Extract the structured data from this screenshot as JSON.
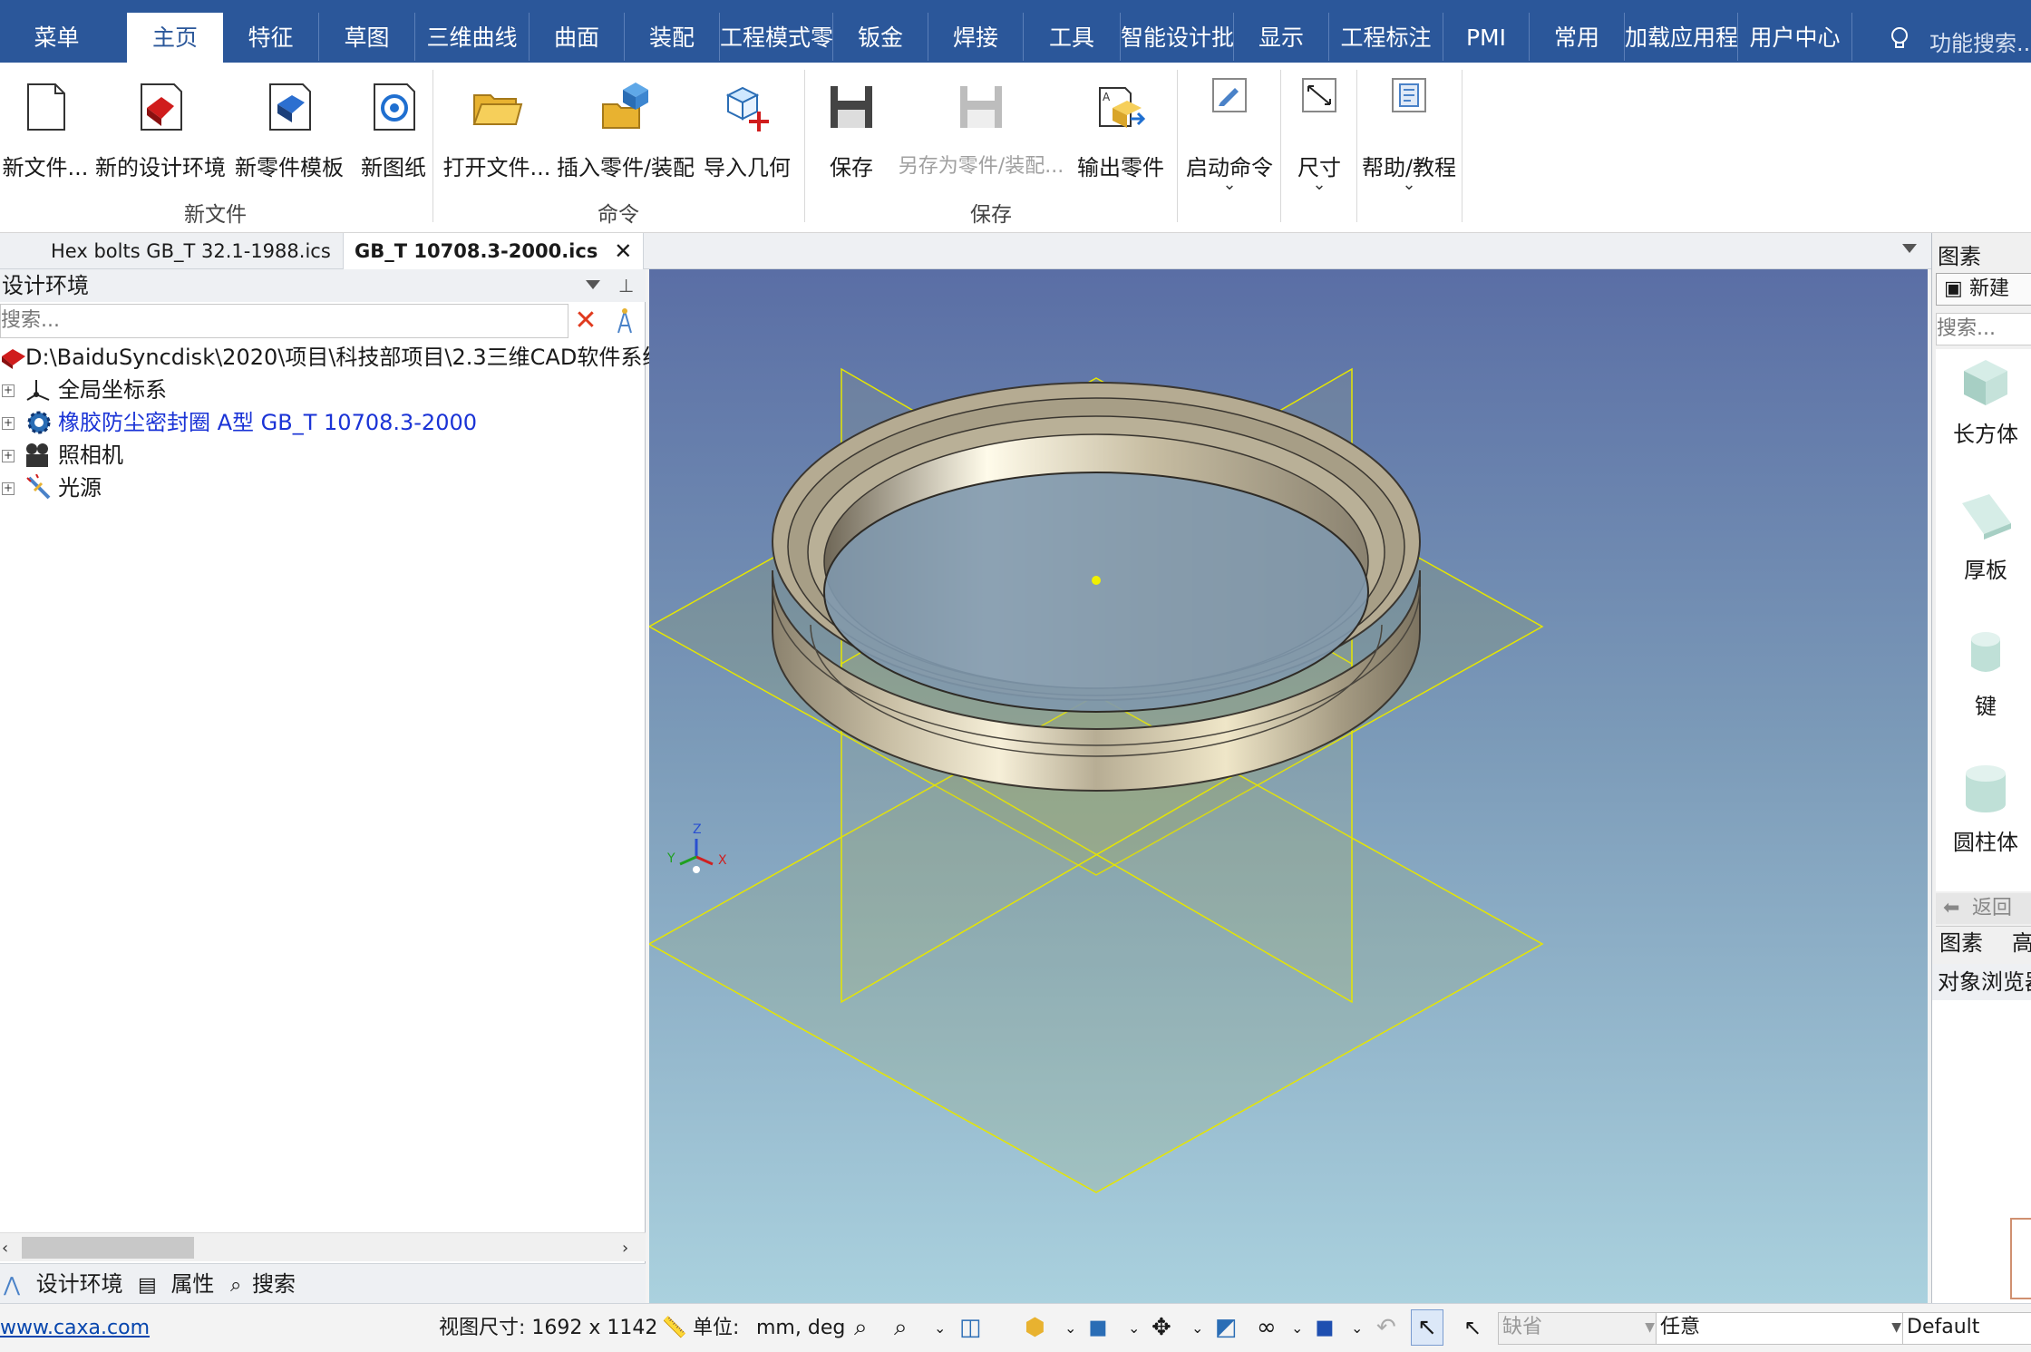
{
  "menubar": {
    "tabs": [
      "菜单",
      "主页",
      "特征",
      "草图",
      "三维曲线",
      "曲面",
      "装配",
      "工程模式零",
      "钣金",
      "焊接",
      "工具",
      "智能设计批",
      "显示",
      "工程标注",
      "PMI",
      "常用",
      "加载应用程",
      "用户中心"
    ],
    "search_placeholder": "功能搜索...",
    "active_tab": "主页"
  },
  "ribbon": {
    "buttons": {
      "new_file": "新文件...",
      "new_design_env": "新的设计环境",
      "new_part_template": "新零件模板",
      "new_drawing": "新图纸",
      "open_file": "打开文件...",
      "insert_part": "插入零件/装配",
      "import_geometry": "导入几何",
      "save": "保存",
      "save_as": "另存为零件/装配...",
      "export_part": "输出零件",
      "start_command": "启动命令",
      "dimension": "尺寸",
      "help": "帮助/教程"
    },
    "groups": {
      "new_file": "新文件",
      "command": "命令",
      "save": "保存"
    }
  },
  "doc_tabs": [
    {
      "label": "Hex bolts GB_T 32.1-1988.ics",
      "active": false
    },
    {
      "label": "GB_T 10708.3-2000.ics",
      "active": true
    }
  ],
  "left_panel": {
    "title": "设计环境",
    "search_placeholder": "搜索...",
    "tree": {
      "root": "D:\\BaiduSyncdisk\\2020\\项目\\科技部项目\\2.3三维CAD软件系统",
      "items": [
        "全局坐标系",
        "橡胶防尘密封圈 A型 GB_T 10708.3-2000",
        "照相机",
        "光源"
      ]
    },
    "bottom_tabs": [
      "设计环境",
      "属性",
      "搜索"
    ]
  },
  "right_panel": {
    "title": "图素",
    "new_button": "新建",
    "search_placeholder": "搜索...",
    "items": [
      "长方体",
      "厚板",
      "键",
      "圆柱体"
    ],
    "back_button": "返回",
    "bottom_tabs": [
      "图素",
      "高"
    ],
    "browser_title": "对象浏览器"
  },
  "viewport": {
    "axis_labels": {
      "x": "X",
      "y": "Y",
      "z": "Z"
    }
  },
  "statusbar": {
    "link": "www.caxa.com",
    "view_size": "视图尺寸: 1692 x 1142",
    "unit_label": "单位:",
    "unit_value": "mm, deg",
    "select_default": "缺省",
    "select_any": "任意",
    "select_style": "Default"
  },
  "colors": {
    "menubar": "#2b579a",
    "viewport_top": "#5b6fa6",
    "viewport_bottom": "#a9d1dd",
    "ring": "#c8bea4",
    "plane_line": "#e6e600",
    "link": "#0645ad"
  }
}
